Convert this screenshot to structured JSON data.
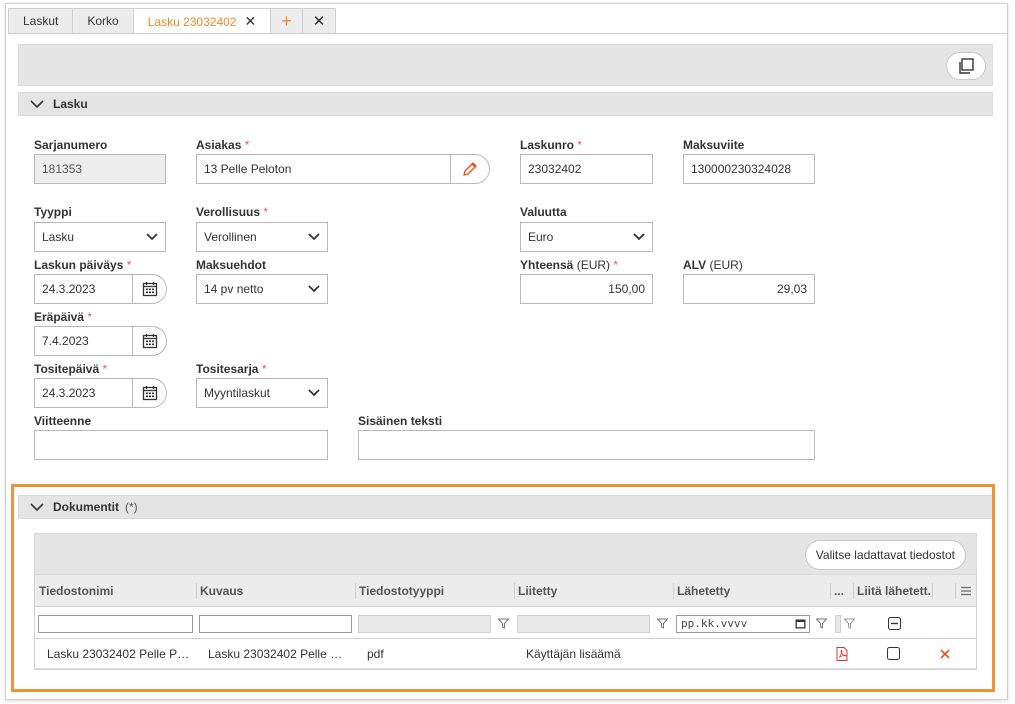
{
  "tabs": [
    {
      "label": "Laskut"
    },
    {
      "label": "Korko"
    },
    {
      "label": "Lasku 23032402"
    }
  ],
  "lasku_section": {
    "title": "Lasku"
  },
  "form": {
    "sarjanumero": {
      "label": "Sarjanumero",
      "value": "181353"
    },
    "asiakas": {
      "label": "Asiakas",
      "value": "13 Pelle Peloton"
    },
    "laskunro": {
      "label": "Laskunro",
      "value": "23032402"
    },
    "maksuviite": {
      "label": "Maksuviite",
      "value": "130000230324028"
    },
    "tyyppi": {
      "label": "Tyyppi",
      "value": "Lasku"
    },
    "verollisuus": {
      "label": "Verollisuus",
      "value": "Verollinen"
    },
    "valuutta": {
      "label": "Valuutta",
      "value": "Euro"
    },
    "laskun_paivays": {
      "label": "Laskun päiväys",
      "value": "24.3.2023"
    },
    "maksuehdot": {
      "label": "Maksuehdot",
      "value": "14 pv netto"
    },
    "yhteensa": {
      "label": "Yhteensä",
      "unit": "(EUR)",
      "value": "150,00"
    },
    "alv": {
      "label": "ALV",
      "unit": "(EUR)",
      "value": "29,03"
    },
    "erapaiva": {
      "label": "Eräpäivä",
      "value": "7.4.2023"
    },
    "tositepaiva": {
      "label": "Tositepäivä",
      "value": "24.3.2023"
    },
    "tositesarja": {
      "label": "Tositesarja",
      "value": "Myyntilaskut"
    },
    "viitteenne": {
      "label": "Viitteenne",
      "value": ""
    },
    "sisainen_teksti": {
      "label": "Sisäinen teksti",
      "value": ""
    },
    "required_mark": "*"
  },
  "documents": {
    "title": "Dokumentit",
    "count_mark": "(*)",
    "upload_label": "Valitse ladattavat tiedostot",
    "columns": [
      "Tiedostonimi",
      "Kuvaus",
      "Tiedostotyyppi",
      "Liitetty",
      "Lähetetty",
      "...",
      "Liitä lähetett..."
    ],
    "date_placeholder": "pp.kk.vvvv",
    "rows": [
      {
        "tiedostonimi": "Lasku 23032402 Pelle Pelo...",
        "kuvaus": "Lasku 23032402 Pelle Pel...",
        "tyyppi": "pdf",
        "liitetty": "Käyttäjän lisäämä",
        "lahetetty": ""
      }
    ]
  },
  "colors": {
    "accent": "#ef8a27",
    "highlight": "#f0923a",
    "required": "#e55555",
    "delete": "#e8541d",
    "pdf": "#d33"
  },
  "icons": [
    "close-icon",
    "plus-icon",
    "copy-icon",
    "chevron-down-icon",
    "pencil-icon",
    "calendar-icon",
    "funnel-icon",
    "pdf-icon",
    "menu-icon",
    "delete-icon"
  ]
}
